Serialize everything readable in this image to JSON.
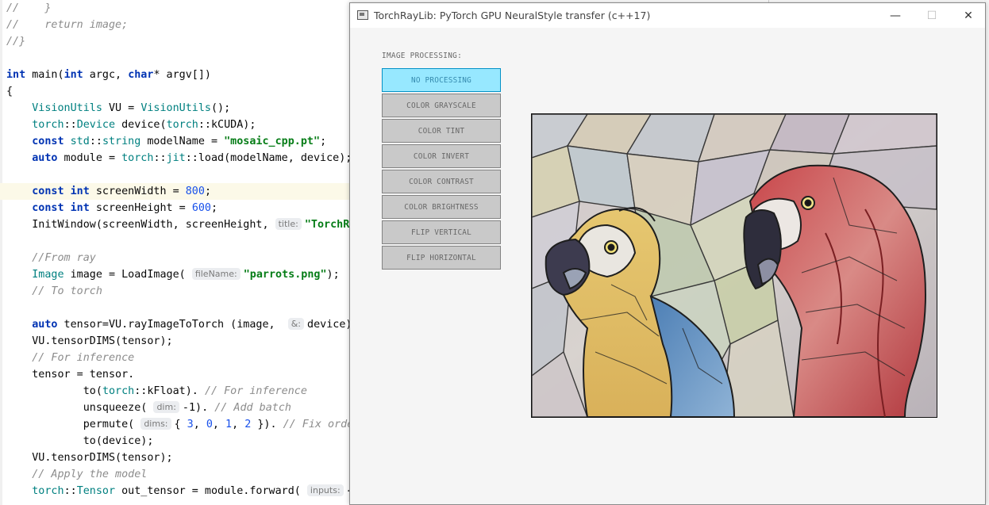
{
  "editor": {
    "lines": [
      {
        "kind": "plain",
        "segments": [
          {
            "t": "//    }",
            "c": "cm"
          }
        ]
      },
      {
        "kind": "plain",
        "segments": [
          {
            "t": "//    return image;",
            "c": "cm"
          }
        ]
      },
      {
        "kind": "plain",
        "segments": [
          {
            "t": "//}",
            "c": "cm"
          }
        ]
      },
      {
        "kind": "plain",
        "segments": []
      },
      {
        "kind": "plain",
        "segments": [
          {
            "t": "int",
            "c": "kw"
          },
          {
            "t": " main(",
            "c": ""
          },
          {
            "t": "int",
            "c": "kw"
          },
          {
            "t": " argc, ",
            "c": ""
          },
          {
            "t": "char",
            "c": "kw"
          },
          {
            "t": "* argv[])",
            "c": ""
          }
        ]
      },
      {
        "kind": "plain",
        "segments": [
          {
            "t": "{",
            "c": ""
          }
        ]
      },
      {
        "kind": "plain",
        "segments": [
          {
            "t": "    ",
            "c": ""
          },
          {
            "t": "VisionUtils",
            "c": "ty"
          },
          {
            "t": " VU = ",
            "c": ""
          },
          {
            "t": "VisionUtils",
            "c": "ty"
          },
          {
            "t": "();",
            "c": ""
          }
        ]
      },
      {
        "kind": "plain",
        "segments": [
          {
            "t": "    ",
            "c": ""
          },
          {
            "t": "torch",
            "c": "ty"
          },
          {
            "t": "::",
            "c": ""
          },
          {
            "t": "Device",
            "c": "ty"
          },
          {
            "t": " device(",
            "c": ""
          },
          {
            "t": "torch",
            "c": "ty"
          },
          {
            "t": "::kCUDA);",
            "c": ""
          }
        ]
      },
      {
        "kind": "plain",
        "segments": [
          {
            "t": "    ",
            "c": ""
          },
          {
            "t": "const",
            "c": "kw"
          },
          {
            "t": " ",
            "c": ""
          },
          {
            "t": "std",
            "c": "ty"
          },
          {
            "t": "::",
            "c": ""
          },
          {
            "t": "string",
            "c": "ty"
          },
          {
            "t": " modelName = ",
            "c": ""
          },
          {
            "t": "\"mosaic_cpp.pt\"",
            "c": "st"
          },
          {
            "t": ";",
            "c": ""
          }
        ]
      },
      {
        "kind": "plain",
        "segments": [
          {
            "t": "    ",
            "c": ""
          },
          {
            "t": "auto",
            "c": "kw"
          },
          {
            "t": " module = ",
            "c": ""
          },
          {
            "t": "torch",
            "c": "ty"
          },
          {
            "t": "::",
            "c": ""
          },
          {
            "t": "jit",
            "c": "ty"
          },
          {
            "t": "::load(modelName, device);",
            "c": ""
          }
        ]
      },
      {
        "kind": "plain",
        "segments": []
      },
      {
        "kind": "hl",
        "segments": [
          {
            "t": "    ",
            "c": ""
          },
          {
            "t": "const",
            "c": "kw"
          },
          {
            "t": " ",
            "c": ""
          },
          {
            "t": "int",
            "c": "kw"
          },
          {
            "t": " screenWidth = ",
            "c": ""
          },
          {
            "t": "800",
            "c": "nm"
          },
          {
            "t": ";",
            "c": ""
          }
        ]
      },
      {
        "kind": "plain",
        "segments": [
          {
            "t": "    ",
            "c": ""
          },
          {
            "t": "const",
            "c": "kw"
          },
          {
            "t": " ",
            "c": ""
          },
          {
            "t": "int",
            "c": "kw"
          },
          {
            "t": " screenHeight = ",
            "c": ""
          },
          {
            "t": "600",
            "c": "nm"
          },
          {
            "t": ";",
            "c": ""
          }
        ]
      },
      {
        "kind": "plain",
        "segments": [
          {
            "t": "    InitWindow(screenWidth, screenHeight, ",
            "c": ""
          },
          {
            "t": "title:",
            "c": "hint"
          },
          {
            "t": "\"TorchRa",
            "c": "st"
          }
        ]
      },
      {
        "kind": "plain",
        "segments": []
      },
      {
        "kind": "plain",
        "segments": [
          {
            "t": "    ",
            "c": ""
          },
          {
            "t": "//From ray",
            "c": "cm"
          }
        ]
      },
      {
        "kind": "plain",
        "segments": [
          {
            "t": "    ",
            "c": ""
          },
          {
            "t": "Image",
            "c": "ty"
          },
          {
            "t": " image = LoadImage( ",
            "c": ""
          },
          {
            "t": "fileName:",
            "c": "hint"
          },
          {
            "t": "\"parrots.png\"",
            "c": "st"
          },
          {
            "t": ");",
            "c": ""
          }
        ]
      },
      {
        "kind": "plain",
        "segments": [
          {
            "t": "    ",
            "c": ""
          },
          {
            "t": "// To torch",
            "c": "cm"
          }
        ]
      },
      {
        "kind": "plain",
        "segments": []
      },
      {
        "kind": "plain",
        "segments": [
          {
            "t": "    ",
            "c": ""
          },
          {
            "t": "auto",
            "c": "kw"
          },
          {
            "t": " tensor=VU.rayImageToTorch (image,  ",
            "c": ""
          },
          {
            "t": "&:",
            "c": "hint"
          },
          {
            "t": "device);",
            "c": ""
          }
        ]
      },
      {
        "kind": "plain",
        "segments": [
          {
            "t": "    VU.tensorDIMS(tensor);",
            "c": ""
          }
        ]
      },
      {
        "kind": "plain",
        "segments": [
          {
            "t": "    ",
            "c": ""
          },
          {
            "t": "// For inference",
            "c": "cm"
          }
        ]
      },
      {
        "kind": "plain",
        "segments": [
          {
            "t": "    tensor = tensor.",
            "c": ""
          }
        ]
      },
      {
        "kind": "plain",
        "segments": [
          {
            "t": "            to(",
            "c": ""
          },
          {
            "t": "torch",
            "c": "ty"
          },
          {
            "t": "::kFloat). ",
            "c": ""
          },
          {
            "t": "// For inference",
            "c": "cm"
          }
        ]
      },
      {
        "kind": "plain",
        "segments": [
          {
            "t": "            unsqueeze( ",
            "c": ""
          },
          {
            "t": "dim:",
            "c": "hint"
          },
          {
            "t": "-1). ",
            "c": ""
          },
          {
            "t": "// Add batch",
            "c": "cm"
          }
        ]
      },
      {
        "kind": "plain",
        "segments": [
          {
            "t": "            permute( ",
            "c": ""
          },
          {
            "t": "dims:",
            "c": "hint"
          },
          {
            "t": "{ ",
            "c": ""
          },
          {
            "t": "3",
            "c": "nm"
          },
          {
            "t": ", ",
            "c": ""
          },
          {
            "t": "0",
            "c": "nm"
          },
          {
            "t": ", ",
            "c": ""
          },
          {
            "t": "1",
            "c": "nm"
          },
          {
            "t": ", ",
            "c": ""
          },
          {
            "t": "2",
            "c": "nm"
          },
          {
            "t": " }). ",
            "c": ""
          },
          {
            "t": "// Fix order",
            "c": "cm"
          }
        ]
      },
      {
        "kind": "plain",
        "segments": [
          {
            "t": "            to(device);",
            "c": ""
          }
        ]
      },
      {
        "kind": "plain",
        "segments": [
          {
            "t": "    VU.tensorDIMS(tensor);",
            "c": ""
          }
        ]
      },
      {
        "kind": "plain",
        "segments": [
          {
            "t": "    ",
            "c": ""
          },
          {
            "t": "// Apply the model",
            "c": "cm"
          }
        ]
      },
      {
        "kind": "plain",
        "segments": [
          {
            "t": "    ",
            "c": ""
          },
          {
            "t": "torch",
            "c": "ty"
          },
          {
            "t": "::",
            "c": ""
          },
          {
            "t": "Tensor",
            "c": "ty"
          },
          {
            "t": " out_tensor = module.forward( ",
            "c": ""
          },
          {
            "t": "inputs:",
            "c": "hint"
          },
          {
            "t": "{",
            "c": ""
          }
        ]
      }
    ]
  },
  "window": {
    "title": "TorchRayLib: PyTorch GPU NeuralStyle transfer (c++17)",
    "controls": {
      "minimize": "—",
      "maximize": "☐",
      "close": "✕"
    }
  },
  "panel": {
    "section_label": "IMAGE PROCESSING:",
    "buttons": [
      {
        "label": "NO PROCESSING",
        "active": true
      },
      {
        "label": "COLOR GRAYSCALE",
        "active": false
      },
      {
        "label": "COLOR TINT",
        "active": false
      },
      {
        "label": "COLOR INVERT",
        "active": false
      },
      {
        "label": "COLOR CONTRAST",
        "active": false
      },
      {
        "label": "COLOR BRIGHTNESS",
        "active": false
      },
      {
        "label": "FLIP VERTICAL",
        "active": false
      },
      {
        "label": "FLIP HORIZONTAL",
        "active": false
      }
    ]
  },
  "colors": {
    "active_button_bg": "#97e8ff",
    "active_button_border": "#0492c7",
    "button_bg": "#c9c9c9",
    "button_border": "#838383",
    "window_bg": "#f5f5f5"
  }
}
